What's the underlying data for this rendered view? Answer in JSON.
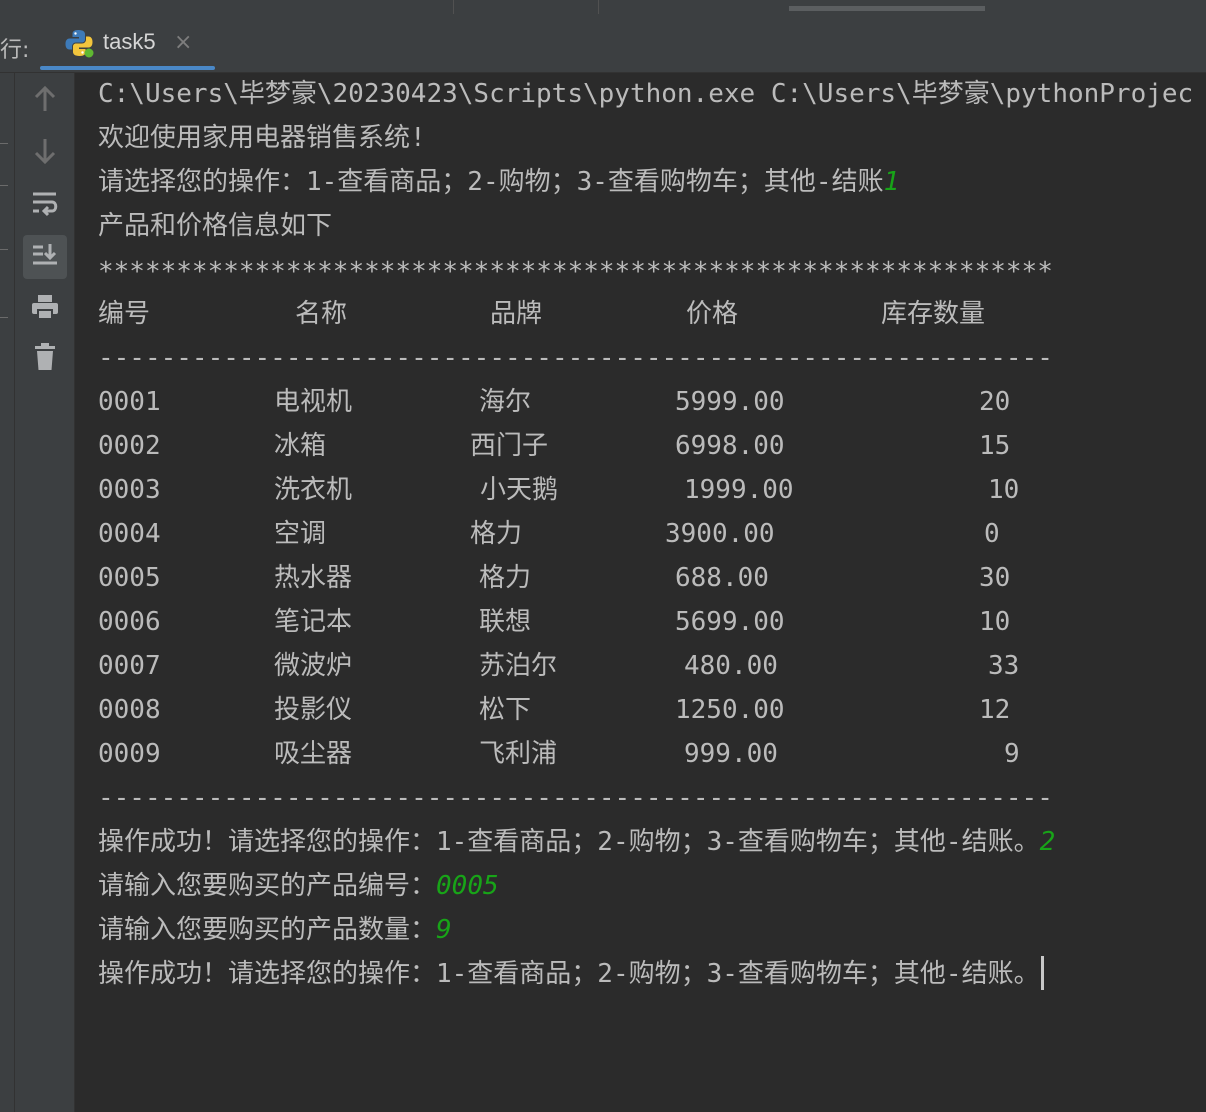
{
  "run_panel": {
    "label": "行:",
    "tab": {
      "title": "task5",
      "close_glyph": "×",
      "icon": "python-icon"
    }
  },
  "toolbar": {
    "buttons": [
      {
        "icon": "arrow-up-icon"
      },
      {
        "icon": "arrow-down-icon"
      },
      {
        "icon": "soft-wrap-icon"
      },
      {
        "icon": "scroll-to-end-icon",
        "active": true
      },
      {
        "icon": "print-icon"
      },
      {
        "icon": "trash-icon"
      }
    ]
  },
  "console": {
    "command": "C:\\Users\\毕梦豪\\20230423\\Scripts\\python.exe C:\\Users\\毕梦豪\\pythonProjec",
    "welcome": "欢迎使用家用电器销售系统!",
    "prompt1": "请选择您的操作：1-查看商品；2-购物；3-查看购物车；其他-结账",
    "input1": "1",
    "info": "产品和价格信息如下",
    "stars": "*************************************************************",
    "dashes": "-------------------------------------------------------------",
    "headers": [
      "编号",
      "名称",
      "品牌",
      "价格",
      "库存数量"
    ],
    "products": [
      {
        "id": "0001",
        "name": "电视机",
        "brand": "海尔",
        "price": "5999.00",
        "stock": "20"
      },
      {
        "id": "0002",
        "name": "冰箱",
        "brand": "西门子",
        "price": "6998.00",
        "stock": "15"
      },
      {
        "id": "0003",
        "name": "洗衣机",
        "brand": "小天鹅",
        "price": "1999.00",
        "stock": "10"
      },
      {
        "id": "0004",
        "name": "空调",
        "brand": "格力",
        "price": "3900.00",
        "stock": "0"
      },
      {
        "id": "0005",
        "name": "热水器",
        "brand": "格力",
        "price": "688.00",
        "stock": "30"
      },
      {
        "id": "0006",
        "name": "笔记本",
        "brand": "联想",
        "price": "5699.00",
        "stock": "10"
      },
      {
        "id": "0007",
        "name": "微波炉",
        "brand": "苏泊尔",
        "price": "480.00",
        "stock": "33"
      },
      {
        "id": "0008",
        "name": "投影仪",
        "brand": "松下",
        "price": "1250.00",
        "stock": "12"
      },
      {
        "id": "0009",
        "name": "吸尘器",
        "brand": "飞利浦",
        "price": "999.00",
        "stock": "9"
      }
    ],
    "prompt2": "操作成功！请选择您的操作：1-查看商品；2-购物；3-查看购物车；其他-结账。",
    "input2": "2",
    "prompt_id": "请输入您要购买的产品编号：",
    "input_id": "0005",
    "prompt_qty": "请输入您要购买的产品数量：",
    "input_qty": "9",
    "prompt3": "操作成功！请选择您的操作：1-查看商品；2-购物；3-查看购物车；其他-结账。"
  },
  "colors": {
    "background": "#2b2b2b",
    "text": "#bbbbbb",
    "user_input": "#18a418",
    "tab_underline": "#4a88c7"
  }
}
